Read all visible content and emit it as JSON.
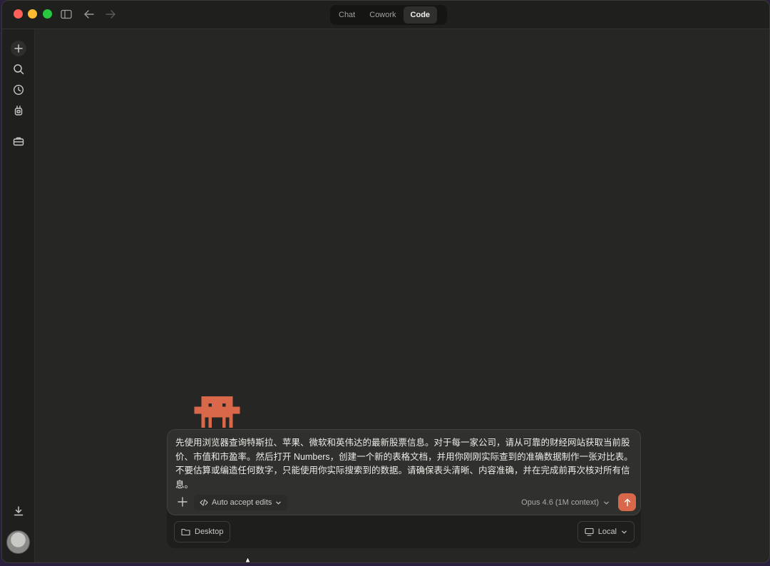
{
  "header": {
    "tabs": [
      {
        "label": "Chat",
        "active": false
      },
      {
        "label": "Cowork",
        "active": false
      },
      {
        "label": "Code",
        "active": true
      }
    ]
  },
  "sidebar": {
    "icons": [
      "plus-icon",
      "search-icon",
      "clock-icon",
      "robot-icon",
      "toolbox-icon",
      "download-icon"
    ]
  },
  "composer": {
    "prompt": "先使用浏览器查询特斯拉、苹果、微软和英伟达的最新股票信息。对于每一家公司，请从可靠的财经网站获取当前股价、市值和市盈率。然后打开 Numbers，创建一个新的表格文档，并用你刚刚实际查到的准确数据制作一张对比表。不要估算或编造任何数字，只能使用你实际搜索到的数据。请确保表头清晰、内容准确，并在完成前再次核对所有信息。",
    "auto_accept_label": "Auto accept edits",
    "model_label": "Opus 4.6 (1M context)",
    "desktop_label": "Desktop",
    "local_label": "Local"
  },
  "colors": {
    "accent": "#d9684a",
    "background": "#262624",
    "sidebar": "#1f1f1e"
  }
}
